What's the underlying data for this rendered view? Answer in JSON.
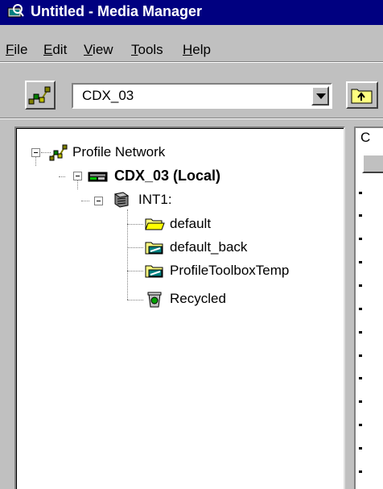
{
  "window": {
    "title": "Untitled - Media Manager"
  },
  "menu": {
    "items": [
      {
        "label_key": "F",
        "label_rest": "ile"
      },
      {
        "label_key": "E",
        "label_rest": "dit"
      },
      {
        "label_key": "V",
        "label_rest": "iew"
      },
      {
        "label_key": "T",
        "label_rest": "ools"
      },
      {
        "label_key": "H",
        "label_rest": "elp"
      }
    ]
  },
  "toolbar": {
    "network_button_icon": "network-icon",
    "machine_select": {
      "value": "CDX_03"
    },
    "up_folder_icon": "folder-up-icon"
  },
  "tree": {
    "root": {
      "label": "Profile Network",
      "icon": "network-icon"
    },
    "machine": {
      "label": "CDX_03 (Local)",
      "icon": "machine-icon"
    },
    "volume": {
      "label": "INT1:",
      "icon": "drive-icon"
    },
    "folders": [
      {
        "label": "default",
        "icon": "open-folder-icon"
      },
      {
        "label": "default_back",
        "icon": "folder-icon"
      },
      {
        "label": "ProfileToolboxTemp",
        "icon": "folder-icon"
      },
      {
        "label": "Recycled",
        "icon": "recycle-bin-icon"
      }
    ]
  },
  "right_pane": {
    "header_text": "C"
  }
}
